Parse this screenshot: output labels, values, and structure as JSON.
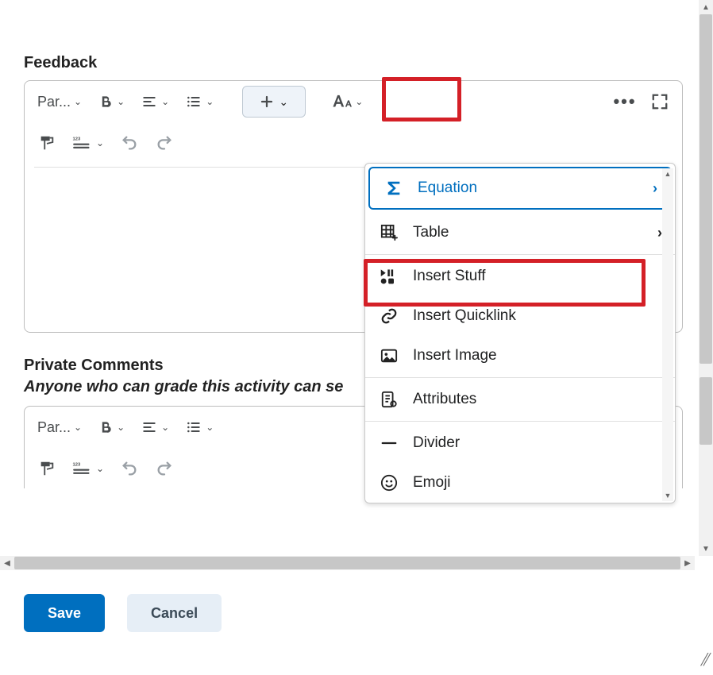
{
  "sections": {
    "feedback_label": "Feedback",
    "private_comments_label": "Private Comments",
    "private_comments_note": "Anyone who can grade this activity can se"
  },
  "toolbar": {
    "paragraph_label": "Par...",
    "more_label": "•••"
  },
  "insert_menu": {
    "equation": "Equation",
    "table": "Table",
    "insert_stuff": "Insert Stuff",
    "insert_quicklink": "Insert Quicklink",
    "insert_image": "Insert Image",
    "attributes": "Attributes",
    "divider": "Divider",
    "emoji": "Emoji"
  },
  "footer": {
    "save": "Save",
    "cancel": "Cancel"
  }
}
